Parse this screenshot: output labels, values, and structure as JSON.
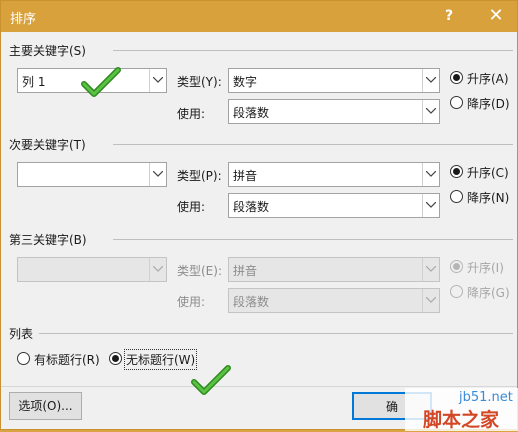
{
  "window": {
    "title": "排序",
    "help": "?",
    "close": "✕"
  },
  "keys": [
    {
      "label": "主要关键字(S)",
      "value": "列 1",
      "type_label": "类型(Y):",
      "type_value": "数字",
      "use_label": "使用:",
      "use_value": "段落数",
      "asc": "升序(A)",
      "desc": "降序(D)",
      "order": "asc",
      "enabled": true
    },
    {
      "label": "次要关键字(T)",
      "value": "",
      "type_label": "类型(P):",
      "type_value": "拼音",
      "use_label": "使用:",
      "use_value": "段落数",
      "asc": "升序(C)",
      "desc": "降序(N)",
      "order": "asc",
      "enabled": true
    },
    {
      "label": "第三关键字(B)",
      "value": "",
      "type_label": "类型(E):",
      "type_value": "拼音",
      "use_label": "使用:",
      "use_value": "段落数",
      "asc": "升序(I)",
      "desc": "降序(G)",
      "order": "asc",
      "enabled": false
    }
  ],
  "list": {
    "label": "列表",
    "header_row": "有标题行(R)",
    "no_header_row": "无标题行(W)",
    "selected": "no_header_row"
  },
  "buttons": {
    "options": "选项(O)...",
    "ok": "确"
  },
  "watermark": {
    "url": "jb51.net",
    "name": "脚本之家"
  },
  "colors": {
    "titlebar": "#d8a13c",
    "check": "#3aa02e",
    "default_button_border": "#0078d7"
  }
}
